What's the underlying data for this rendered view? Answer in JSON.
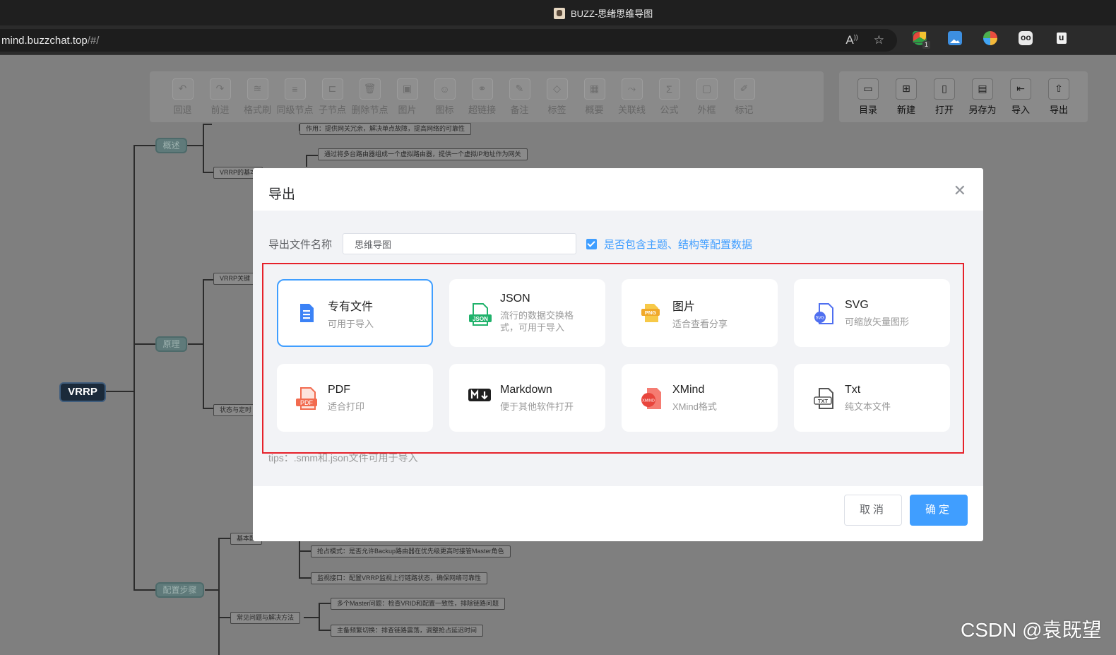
{
  "window": {
    "title": "BUZZ-思绪思维导图"
  },
  "address": {
    "host": "mind.buzzchat.top",
    "path": "/#/"
  },
  "toolbar": {
    "items": [
      {
        "label": "回退",
        "icon": "undo-icon",
        "glyph": "↶"
      },
      {
        "label": "前进",
        "icon": "redo-icon",
        "glyph": "↷"
      },
      {
        "label": "格式刷",
        "icon": "format-brush-icon",
        "glyph": "≋"
      },
      {
        "label": "同级节点",
        "icon": "sibling-node-icon",
        "glyph": "≡"
      },
      {
        "label": "子节点",
        "icon": "child-node-icon",
        "glyph": "⊏"
      },
      {
        "label": "删除节点",
        "icon": "delete-icon",
        "glyph": "🗑"
      },
      {
        "label": "图片",
        "icon": "image-icon",
        "glyph": "▣"
      },
      {
        "label": "图标",
        "icon": "emoji-icon",
        "glyph": "☺"
      },
      {
        "label": "超链接",
        "icon": "link-icon",
        "glyph": "⚭"
      },
      {
        "label": "备注",
        "icon": "note-icon",
        "glyph": "✎"
      },
      {
        "label": "标签",
        "icon": "tag-icon",
        "glyph": "◇"
      },
      {
        "label": "概要",
        "icon": "summary-icon",
        "glyph": "▦"
      },
      {
        "label": "关联线",
        "icon": "association-line-icon",
        "glyph": "⤳"
      },
      {
        "label": "公式",
        "icon": "formula-icon",
        "glyph": "Σ"
      },
      {
        "label": "外框",
        "icon": "outer-frame-icon",
        "glyph": "▢"
      },
      {
        "label": "标记",
        "icon": "mark-icon",
        "glyph": "✐"
      }
    ],
    "right_items": [
      {
        "label": "目录",
        "icon": "folder-icon",
        "glyph": "▭"
      },
      {
        "label": "新建",
        "icon": "new-file-icon",
        "glyph": "⊞"
      },
      {
        "label": "打开",
        "icon": "open-file-icon",
        "glyph": "▯"
      },
      {
        "label": "另存为",
        "icon": "save-as-icon",
        "glyph": "▤"
      },
      {
        "label": "导入",
        "icon": "import-icon",
        "glyph": "⇤"
      },
      {
        "label": "导出",
        "icon": "export-icon",
        "glyph": "⇧"
      }
    ]
  },
  "mindmap": {
    "root": "VRRP",
    "branches": [
      "概述",
      "原理",
      "配置步骤"
    ],
    "leaves": [
      "作用：提供网关冗余，解决单点故障，提高网络的可靠性",
      "通过将多台路由器组成一个虚拟路由器，提供一个虚拟IP地址作为网关",
      "VRRP的基本",
      "VRRP关键",
      "状态与定时",
      "基本配",
      "抢占模式：是否允许Backup路由器在优先级更高时接管Master角色",
      "监视接口：配置VRRP监视上行链路状态，确保网络可靠性",
      "常见问题与解决方法",
      "多个Master问题：检查VRID和配置一致性，排除链路问题",
      "主备频繁切换：排查链路震荡，调整抢占延迟时间"
    ]
  },
  "export_dialog": {
    "title": "导出",
    "filename_label": "导出文件名称",
    "filename_value": "思维导图",
    "include_config_label": "是否包含主题、结构等配置数据",
    "include_config_checked": true,
    "formats": [
      {
        "name": "专有文件",
        "desc": "可用于导入",
        "icon": "smm-file-icon",
        "selected": true
      },
      {
        "name": "JSON",
        "desc": "流行的数据交换格式，可用于导入",
        "icon": "json-file-icon",
        "selected": false
      },
      {
        "name": "图片",
        "desc": "适合查看分享",
        "icon": "png-file-icon",
        "selected": false
      },
      {
        "name": "SVG",
        "desc": "可缩放矢量图形",
        "icon": "svg-file-icon",
        "selected": false
      },
      {
        "name": "PDF",
        "desc": "适合打印",
        "icon": "pdf-file-icon",
        "selected": false
      },
      {
        "name": "Markdown",
        "desc": "便于其他软件打开",
        "icon": "markdown-icon",
        "selected": false
      },
      {
        "name": "XMind",
        "desc": "XMind格式",
        "icon": "xmind-file-icon",
        "selected": false
      },
      {
        "name": "Txt",
        "desc": "纯文本文件",
        "icon": "txt-file-icon",
        "selected": false
      }
    ],
    "tips": "tips：.smm和.json文件可用于导入",
    "cancel_label": "取消",
    "confirm_label": "确定"
  },
  "watermark": "CSDN @袁既望",
  "colors": {
    "accent": "#409eff",
    "highlight_frame": "#e6212a"
  }
}
